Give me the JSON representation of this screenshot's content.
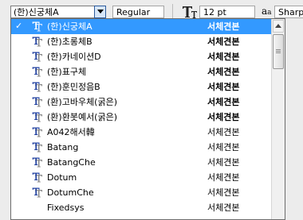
{
  "toolbar": {
    "font_family": "(한)신궁체A",
    "font_style": "Regular",
    "font_size": "12 pt",
    "aa_icon_big": "a",
    "aa_icon_small": "a",
    "anti_alias": "Sharp",
    "colors": {
      "combo_button": "#d7e6f8",
      "combo_button_border": "#2c5a9b"
    }
  },
  "font_list": {
    "selected_index": 0,
    "check_mark": "✓",
    "highlight_color": "#3399ff",
    "items": [
      {
        "name": "(한)신궁체A",
        "sample": "서체견본",
        "icon": "truetype-icon"
      },
      {
        "name": "(한)초롱체B",
        "sample": "서체견본",
        "icon": "truetype-icon"
      },
      {
        "name": "(한)카네이션D",
        "sample": "서체견본",
        "icon": "truetype-icon"
      },
      {
        "name": "(한)표구체",
        "sample": "서체견본",
        "icon": "truetype-icon"
      },
      {
        "name": "(한)훈민정음B",
        "sample": "서체견본",
        "icon": "truetype-icon"
      },
      {
        "name": "(환)고바우체(굵은)",
        "sample": "서체견본",
        "icon": "truetype-icon"
      },
      {
        "name": "(환)환봇예서(굵은)",
        "sample": "서체견본",
        "icon": "truetype-icon"
      },
      {
        "name": "A042해서韓",
        "sample": "서체견본",
        "icon": "truetype-icon"
      },
      {
        "name": "Batang",
        "sample": "서체견본",
        "icon": "truetype-icon"
      },
      {
        "name": "BatangChe",
        "sample": "서체견본",
        "icon": "truetype-icon"
      },
      {
        "name": "Dotum",
        "sample": "서체견본",
        "icon": "truetype-icon"
      },
      {
        "name": "DotumChe",
        "sample": "서체견본",
        "icon": "truetype-icon"
      },
      {
        "name": "Fixedsys",
        "sample": "서체견본",
        "icon": "none"
      }
    ]
  }
}
